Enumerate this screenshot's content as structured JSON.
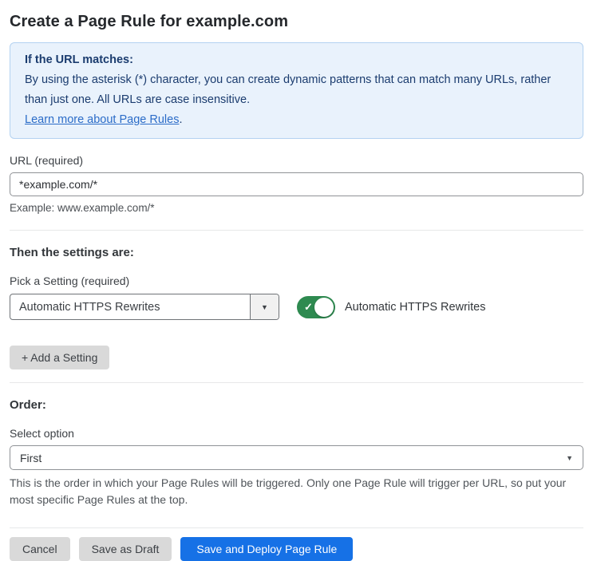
{
  "page": {
    "title": "Create a Page Rule for example.com"
  },
  "info_box": {
    "title": "If the URL matches:",
    "body": "By using the asterisk (*) character, you can create dynamic patterns that can match many URLs, rather than just one. All URLs are case insensitive.",
    "link": "Learn more about Page Rules",
    "link_suffix": "."
  },
  "url_field": {
    "label": "URL (required)",
    "value": "*example.com/*",
    "helper": "Example: www.example.com/*"
  },
  "settings": {
    "heading": "Then the settings are:",
    "picker_label": "Pick a Setting (required)",
    "picker_value": "Automatic HTTPS Rewrites",
    "picker_arrow": "▼",
    "toggle_state": "on",
    "toggle_check": "✓",
    "toggle_label": "Automatic HTTPS Rewrites",
    "add_button": "+ Add a Setting"
  },
  "order": {
    "heading": "Order:",
    "select_label": "Select option",
    "select_value": "First",
    "select_arrow": "▼",
    "helper": "This is the order in which your Page Rules will be triggered. Only one Page Rule will trigger per URL, so put your most specific Page Rules at the top."
  },
  "footer": {
    "cancel": "Cancel",
    "save_draft": "Save as Draft",
    "save_deploy": "Save and Deploy Page Rule"
  },
  "colors": {
    "info_bg": "#e9f2fc",
    "info_border": "#b4d2f1",
    "info_text": "#1b3c6f",
    "link": "#2b6cc8",
    "toggle_on": "#2e8a50",
    "primary_button": "#1671e6",
    "secondary_button": "#d9d9d9"
  }
}
